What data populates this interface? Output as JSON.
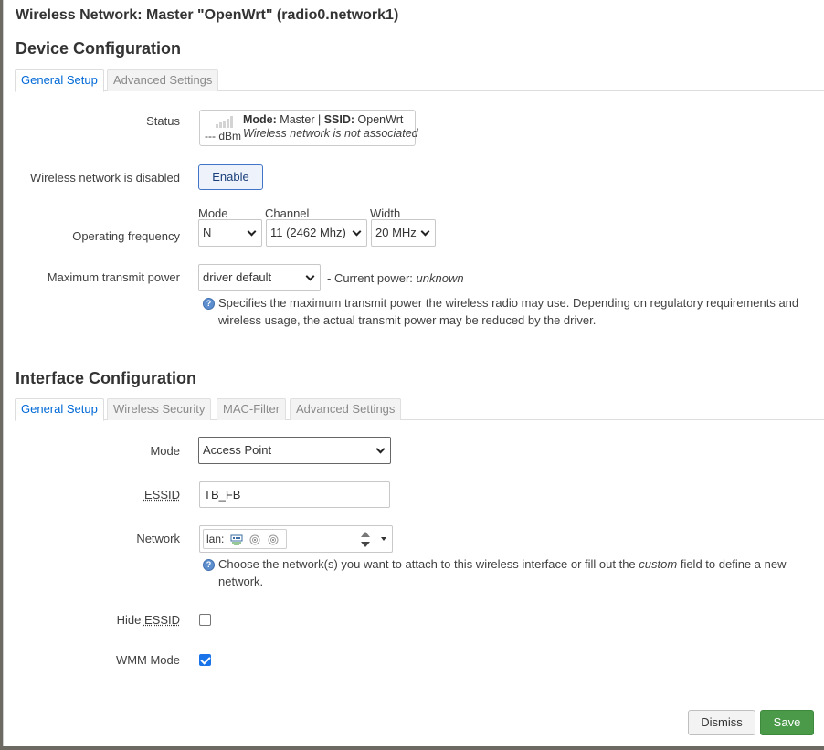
{
  "dialog": {
    "title": "Wireless Network: Master \"OpenWrt\" (radio0.network1)"
  },
  "device": {
    "section_title": "Device Configuration",
    "tabs": [
      {
        "label": "General Setup",
        "active": true
      },
      {
        "label": "Advanced Settings",
        "active": false
      }
    ],
    "status": {
      "label": "Status",
      "signal": "--- dBm",
      "mode_label": "Mode:",
      "mode_value": "Master",
      "separator": "|",
      "ssid_label": "SSID:",
      "ssid_value": "OpenWrt",
      "association": "Wireless network is not associated"
    },
    "disabled": {
      "label": "Wireless network is disabled",
      "button": "Enable"
    },
    "frequency": {
      "label": "Operating frequency",
      "mode_label": "Mode",
      "mode_value": "N",
      "channel_label": "Channel",
      "channel_value": "11 (2462 Mhz)",
      "width_label": "Width",
      "width_value": "20 MHz"
    },
    "txpower": {
      "label": "Maximum transmit power",
      "value": "driver default",
      "current_prefix": "- Current power:",
      "current_value": "unknown",
      "help": "Specifies the maximum transmit power the wireless radio may use. Depending on regulatory requirements and wireless usage, the actual transmit power may be reduced by the driver."
    }
  },
  "iface": {
    "section_title": "Interface Configuration",
    "tabs": [
      {
        "label": "General Setup",
        "active": true
      },
      {
        "label": "Wireless Security",
        "active": false
      },
      {
        "label": "MAC-Filter",
        "active": false
      },
      {
        "label": "Advanced Settings",
        "active": false
      }
    ],
    "mode": {
      "label": "Mode",
      "value": "Access Point"
    },
    "essid": {
      "label": "ESSID",
      "value": "TB_FB"
    },
    "network": {
      "label": "Network",
      "chip": "lan:",
      "help_before": "Choose the network(s) you want to attach to this wireless interface or fill out the",
      "help_em": "custom",
      "help_after": "field to define a new network."
    },
    "hide_essid": {
      "label_prefix": "Hide",
      "label_abbr": "ESSID",
      "checked": false
    },
    "wmm": {
      "label": "WMM Mode",
      "checked": true
    }
  },
  "footer": {
    "dismiss": "Dismiss",
    "save": "Save"
  },
  "colors": {
    "active_tab": "#0069d6",
    "save_button": "#4a9a4a",
    "checkbox_checked": "#1a73e8"
  }
}
